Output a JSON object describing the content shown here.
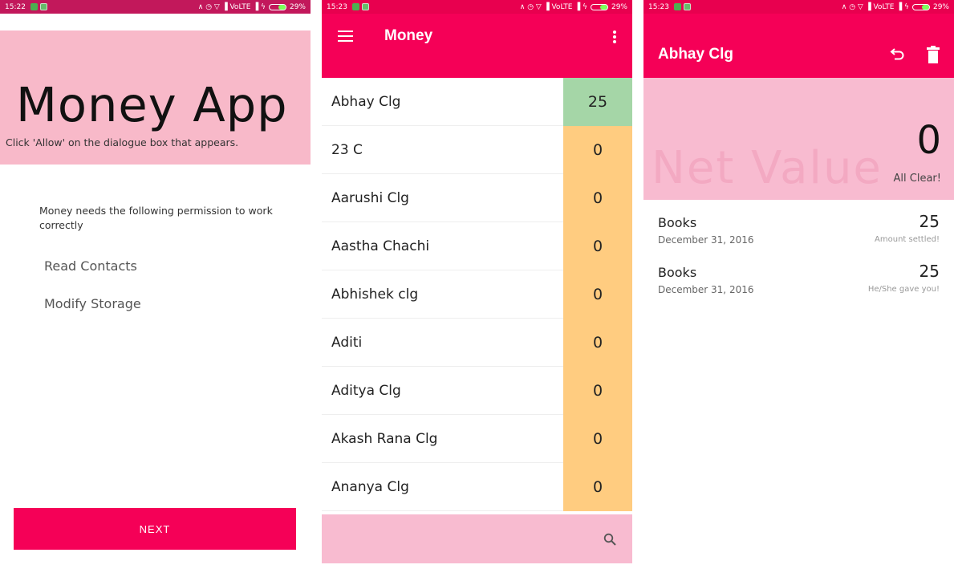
{
  "screen1": {
    "status": {
      "time": "15:22",
      "icons": "∧ ◷ ▽ ▐ VoLTE ▐ ϟ",
      "battery": "29%"
    },
    "hero_title": "Money App",
    "hero_subtitle": "Click 'Allow' on the dialogue box that appears.",
    "permission_intro": "Money needs the following permission to work correctly",
    "permissions": [
      "Read Contacts",
      "Modify Storage"
    ],
    "next_label": "NEXT"
  },
  "screen2": {
    "status": {
      "time": "15:23",
      "icons": "∧ ◷ ▽ ▐ VoLTE ▐ ϟ",
      "battery": "29%"
    },
    "title": "Money",
    "contacts": [
      {
        "name": "Abhay Clg",
        "amount": "25"
      },
      {
        "name": "23 C",
        "amount": "0"
      },
      {
        "name": "Aarushi Clg",
        "amount": "0"
      },
      {
        "name": "Aastha Chachi",
        "amount": "0"
      },
      {
        "name": "Abhishek clg",
        "amount": "0"
      },
      {
        "name": "Aditi",
        "amount": "0"
      },
      {
        "name": "Aditya Clg",
        "amount": "0"
      },
      {
        "name": "Akash Rana Clg",
        "amount": "0"
      },
      {
        "name": "Ananya Clg",
        "amount": "0"
      }
    ],
    "icons": {
      "menu": "menu-icon",
      "overflow": "more-vert-icon",
      "search": "search-icon"
    }
  },
  "screen3": {
    "status": {
      "time": "15:23",
      "icons": "∧ ◷ ▽ ▐ VoLTE ▐ ϟ",
      "battery": "29%"
    },
    "title": "Abhay Clg",
    "watermark": "Net Value",
    "net_value": "0",
    "net_status": "All Clear!",
    "transactions": [
      {
        "title": "Books",
        "date": "December 31, 2016",
        "amount": "25",
        "note": "Amount settled!"
      },
      {
        "title": "Books",
        "date": "December 31, 2016",
        "amount": "25",
        "note": "He/She gave you!"
      }
    ],
    "icons": {
      "undo": "undo-icon",
      "delete": "trash-icon"
    }
  },
  "colors": {
    "accent": "#f50057",
    "pink_light": "#f8bbd0",
    "positive": "#a5d6a7",
    "neutral_amount": "#ffcc80"
  }
}
